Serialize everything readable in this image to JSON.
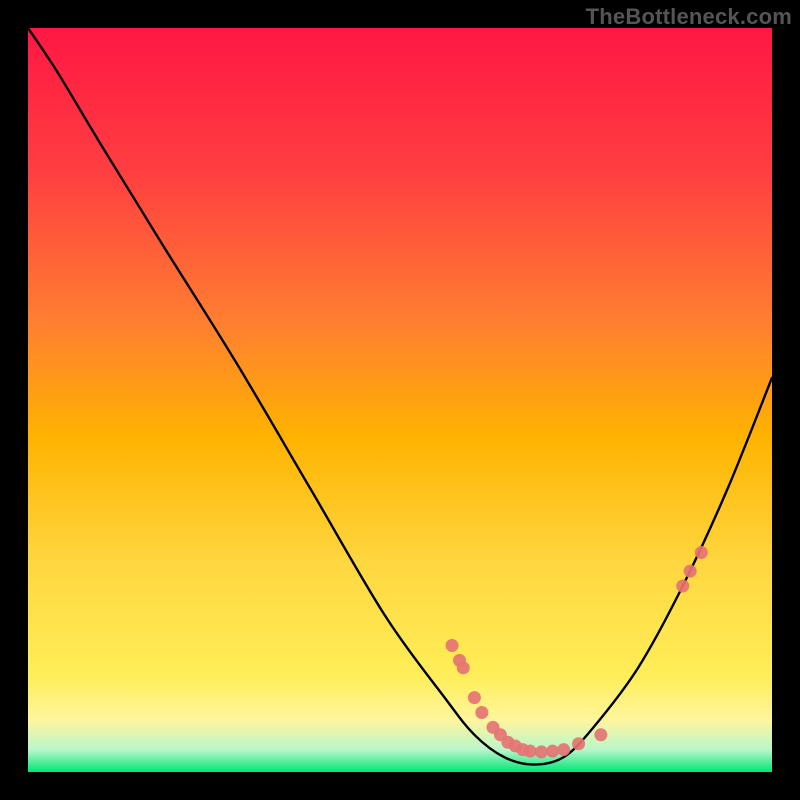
{
  "watermark": "TheBottleneck.com",
  "chart_data": {
    "type": "line",
    "title": "",
    "xlabel": "",
    "ylabel": "",
    "xlim": [
      0,
      100
    ],
    "ylim": [
      0,
      100
    ],
    "grid": false,
    "legend": false,
    "background_gradient": {
      "top": "#ff1744",
      "upper_mid": "#ff7043",
      "mid": "#ffb300",
      "lower_mid": "#ffee58",
      "bottom_band": "#fff59d",
      "very_bottom": "#00e676"
    },
    "series": [
      {
        "name": "bottleneck-curve",
        "color": "#000000",
        "x": [
          0,
          4,
          10,
          18,
          28,
          38,
          48,
          56,
          60,
          64,
          68,
          72,
          76,
          82,
          88,
          94,
          100
        ],
        "y": [
          100,
          94,
          84,
          71,
          55,
          38,
          21,
          10,
          5,
          2,
          1,
          2,
          6,
          14,
          25,
          38,
          53
        ]
      }
    ],
    "markers": [
      {
        "name": "curve-points",
        "color": "#e57373",
        "x": [
          57,
          58,
          58.5,
          60,
          61,
          62.5,
          63.5,
          64.5,
          65.5,
          66.5,
          67.5,
          69,
          70.5,
          72,
          74,
          77,
          88,
          89,
          90.5
        ],
        "y": [
          17,
          15,
          14,
          10,
          8,
          6,
          5,
          4,
          3.5,
          3,
          2.8,
          2.7,
          2.8,
          3,
          3.8,
          5,
          25,
          27,
          29.5
        ]
      }
    ]
  }
}
